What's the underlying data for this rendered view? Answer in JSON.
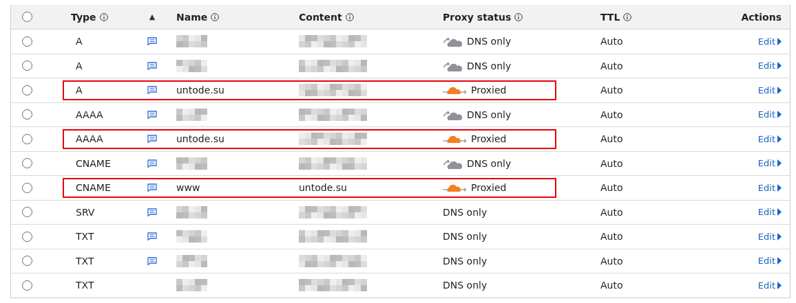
{
  "table": {
    "columns": [
      {
        "label": "Type",
        "info": true,
        "kind": "text"
      },
      {
        "label": "▲",
        "info": false,
        "kind": "sort"
      },
      {
        "label": "Name",
        "info": true,
        "kind": "text"
      },
      {
        "label": "Content",
        "info": true,
        "kind": "text"
      },
      {
        "label": "Proxy status",
        "info": true,
        "kind": "text"
      },
      {
        "label": "TTL",
        "info": true,
        "kind": "text"
      },
      {
        "label": "Actions",
        "info": false,
        "kind": "right"
      }
    ],
    "all_checked": false,
    "rows": [
      {
        "checked": false,
        "type": "A",
        "comment": true,
        "name_hidden": true,
        "content_hidden": true,
        "proxy": {
          "kind": "dns_only",
          "label": "DNS only"
        },
        "ttl": "Auto",
        "action": "Edit",
        "highlighted": false
      },
      {
        "checked": false,
        "type": "A",
        "comment": true,
        "name_hidden": true,
        "content_hidden": true,
        "proxy": {
          "kind": "dns_only",
          "label": "DNS only"
        },
        "ttl": "Auto",
        "action": "Edit",
        "highlighted": false
      },
      {
        "checked": false,
        "type": "A",
        "comment": true,
        "name_hidden": false,
        "name": "untode.su",
        "content_hidden": true,
        "proxy": {
          "kind": "proxied",
          "label": "Proxied"
        },
        "ttl": "Auto",
        "action": "Edit",
        "highlighted": true
      },
      {
        "checked": false,
        "type": "AAAA",
        "comment": true,
        "name_hidden": true,
        "content_hidden": true,
        "proxy": {
          "kind": "dns_only",
          "label": "DNS only"
        },
        "ttl": "Auto",
        "action": "Edit",
        "highlighted": false
      },
      {
        "checked": false,
        "type": "AAAA",
        "comment": true,
        "name_hidden": false,
        "name": "untode.su",
        "content_hidden": true,
        "proxy": {
          "kind": "proxied",
          "label": "Proxied"
        },
        "ttl": "Auto",
        "action": "Edit",
        "highlighted": true
      },
      {
        "checked": false,
        "type": "CNAME",
        "comment": true,
        "name_hidden": true,
        "content_hidden": true,
        "proxy": {
          "kind": "dns_only",
          "label": "DNS only"
        },
        "ttl": "Auto",
        "action": "Edit",
        "highlighted": false
      },
      {
        "checked": false,
        "type": "CNAME",
        "comment": true,
        "name_hidden": false,
        "name": "www",
        "content_hidden": false,
        "content": "untode.su",
        "proxy": {
          "kind": "proxied",
          "label": "Proxied"
        },
        "ttl": "Auto",
        "action": "Edit",
        "highlighted": true
      },
      {
        "checked": false,
        "type": "SRV",
        "comment": true,
        "name_hidden": true,
        "content_hidden": true,
        "proxy": {
          "kind": "none",
          "label": "DNS only"
        },
        "ttl": "Auto",
        "action": "Edit",
        "highlighted": false
      },
      {
        "checked": false,
        "type": "TXT",
        "comment": true,
        "name_hidden": true,
        "content_hidden": true,
        "proxy": {
          "kind": "none",
          "label": "DNS only"
        },
        "ttl": "Auto",
        "action": "Edit",
        "highlighted": false
      },
      {
        "checked": false,
        "type": "TXT",
        "comment": true,
        "name_hidden": true,
        "content_hidden": true,
        "proxy": {
          "kind": "none",
          "label": "DNS only"
        },
        "ttl": "Auto",
        "action": "Edit",
        "highlighted": false
      },
      {
        "checked": false,
        "type": "TXT",
        "comment": false,
        "name_hidden": true,
        "content_hidden": true,
        "proxy": {
          "kind": "none",
          "label": "DNS only"
        },
        "ttl": "Auto",
        "action": "Edit",
        "highlighted": false
      }
    ]
  }
}
